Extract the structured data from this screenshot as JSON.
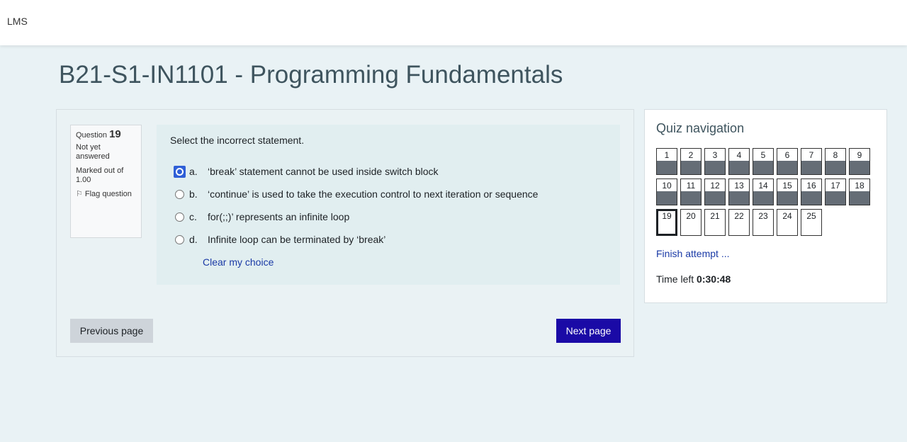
{
  "header": {
    "brand": "LMS"
  },
  "page": {
    "title": "B21-S1-IN1101 - Programming Fundamentals"
  },
  "question_info": {
    "label": "Question",
    "number": "19",
    "state": "Not yet answered",
    "grade": "Marked out of 1.00",
    "flag_label": "Flag question"
  },
  "question": {
    "text": "Select the incorrect statement.",
    "options": [
      {
        "letter": "a.",
        "text": "‘break’ statement cannot be used inside switch block",
        "checked": true
      },
      {
        "letter": "b.",
        "text": "‘continue’ is used to take the execution control to next iteration or sequence",
        "checked": false
      },
      {
        "letter": "c.",
        "text": "for(;;)’ represents an infinite loop",
        "checked": false
      },
      {
        "letter": "d.",
        "text": "Infinite loop can be terminated by ‘break’",
        "checked": false
      }
    ],
    "clear_label": "Clear my choice"
  },
  "buttons": {
    "previous": "Previous page",
    "next": "Next page"
  },
  "quiz_nav": {
    "title": "Quiz navigation",
    "questions": [
      {
        "n": "1",
        "state": "unanswered"
      },
      {
        "n": "2",
        "state": "unanswered"
      },
      {
        "n": "3",
        "state": "unanswered"
      },
      {
        "n": "4",
        "state": "unanswered"
      },
      {
        "n": "5",
        "state": "unanswered"
      },
      {
        "n": "6",
        "state": "unanswered"
      },
      {
        "n": "7",
        "state": "unanswered"
      },
      {
        "n": "8",
        "state": "unanswered"
      },
      {
        "n": "9",
        "state": "unanswered"
      },
      {
        "n": "10",
        "state": "unanswered"
      },
      {
        "n": "11",
        "state": "unanswered"
      },
      {
        "n": "12",
        "state": "unanswered"
      },
      {
        "n": "13",
        "state": "unanswered"
      },
      {
        "n": "14",
        "state": "unanswered"
      },
      {
        "n": "15",
        "state": "unanswered"
      },
      {
        "n": "16",
        "state": "unanswered"
      },
      {
        "n": "17",
        "state": "unanswered"
      },
      {
        "n": "18",
        "state": "unanswered"
      },
      {
        "n": "19",
        "state": "current"
      },
      {
        "n": "20",
        "state": "notseen"
      },
      {
        "n": "21",
        "state": "notseen"
      },
      {
        "n": "22",
        "state": "notseen"
      },
      {
        "n": "23",
        "state": "notseen"
      },
      {
        "n": "24",
        "state": "notseen"
      },
      {
        "n": "25",
        "state": "notseen"
      }
    ],
    "finish_label": "Finish attempt ...",
    "time_label": "Time left",
    "time_value": "0:30:48"
  },
  "colors": {
    "background": "#e9f2f5",
    "accent": "#1a0aa6",
    "link": "#1a3aa6",
    "selected_radio": "#2f5fd7"
  }
}
